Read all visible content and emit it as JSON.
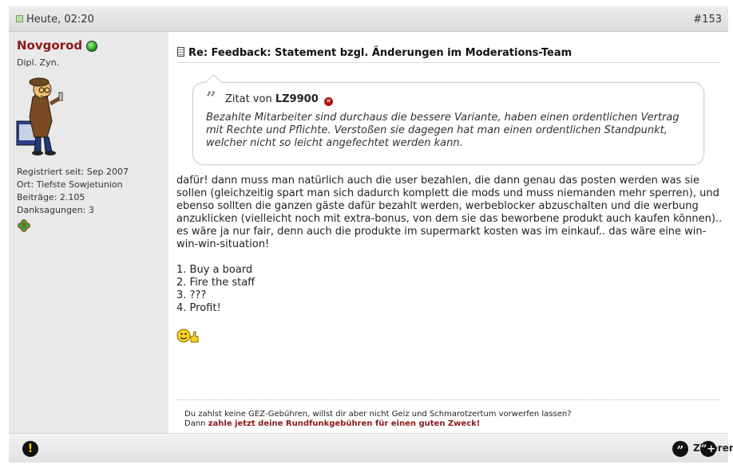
{
  "post": {
    "date": "Heute, 02:20",
    "number": "#153",
    "title": "Re: Feedback: Statement bzgl. Änderungen im Moderations-Team"
  },
  "user": {
    "name": "Novgorod",
    "title": "Dipl. Zyn.",
    "registered": "Registriert seit: Sep 2007",
    "location": "Ort: Tiefste Sowjetunion",
    "posts": "Beiträge: 2.105",
    "thanks": "Danksagungen: 3",
    "status_icon": "online-icon",
    "status_color": "#1c9a14"
  },
  "quote": {
    "prefix": "Zitat von",
    "author": "LZ9900",
    "text": "Bezahlte Mitarbeiter sind durchaus die bessere Variante, haben einen ordentlichen Vertrag mit Rechte und Pflichte. Verstoßen sie dagegen hat man einen ordentlichen Standpunkt, welcher nicht so leicht angefechtet werden kann."
  },
  "message": {
    "paragraph": "dafür! dann muss man natürlich auch die user bezahlen, die dann genau das posten werden was sie sollen (gleichzeitig spart man sich dadurch komplett die mods und muss niemanden mehr sperren), und ebenso sollten die ganzen gäste dafür bezahlt werden, werbeblocker abzuschalten und die werbung anzuklicken (vielleicht noch mit extra-bonus, von dem sie das beworbene produkt auch kaufen können).. es wäre ja nur fair, denn auch die produkte im supermarkt kosten was im einkauf.. das wäre eine win-win-win-situation!",
    "list": [
      "1. Buy a board",
      "2. Fire the staff",
      "3. ???",
      "4. Profit!"
    ]
  },
  "signature": {
    "line1": "Du zahlst keine GEZ-Gebühren, willst dir aber nicht Geiz und Schmarotzertum vorwerfen lassen?",
    "line2_prefix": "Dann",
    "line2_link": "zahle jetzt deine Rundfunkgebühren für einen guten Zweck!"
  },
  "footer": {
    "quote_label": "Zitieren"
  },
  "colors": {
    "username": "#8b1a1a",
    "link": "#8b1a1a",
    "header_bg": "#e3e3e3",
    "sidebar_bg": "#e9e9e9"
  }
}
